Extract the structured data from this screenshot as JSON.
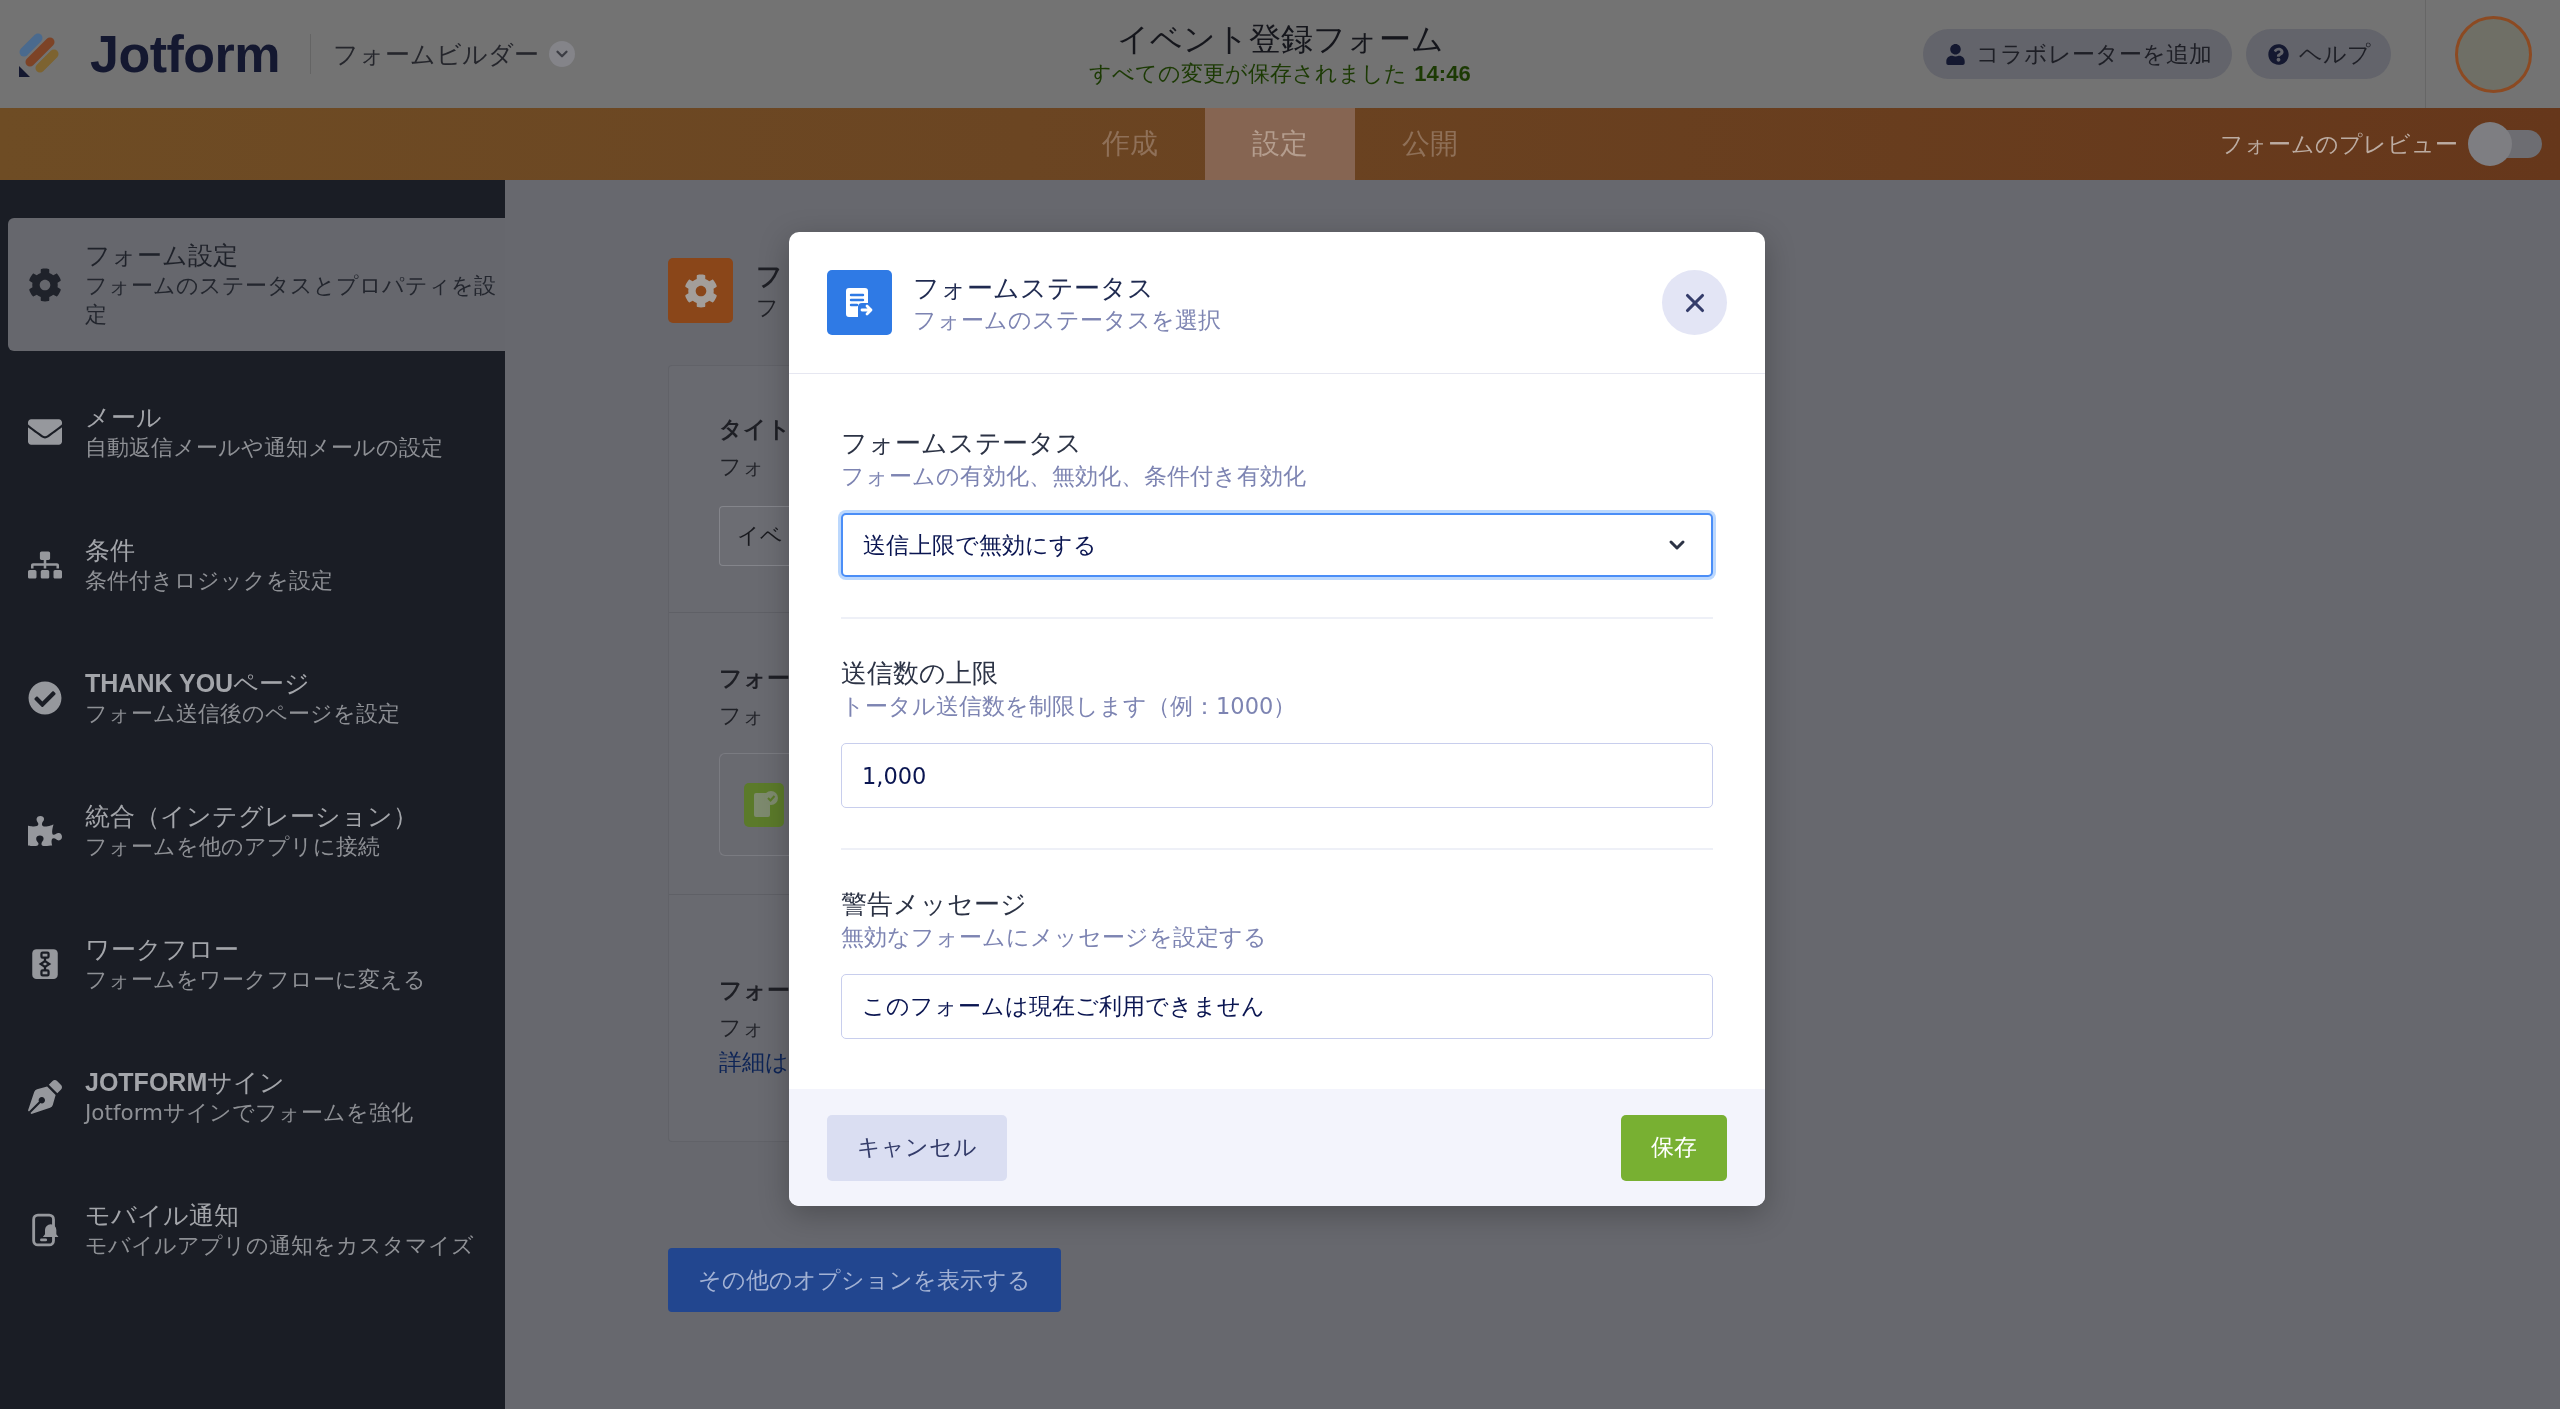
{
  "header": {
    "logo": "Jotform",
    "builder_menu": "フォームビルダー",
    "form_title": "イベント登録フォーム",
    "save_status": "すべての変更が保存されました",
    "save_time": "14:46",
    "buttons": [
      {
        "kind": "collaborator",
        "label": "コラボレーターを追加"
      },
      {
        "kind": "help",
        "label": "ヘルプ"
      }
    ]
  },
  "nav": {
    "tabs": [
      {
        "label": "作成",
        "selected": false
      },
      {
        "label": "設定",
        "selected": true
      },
      {
        "label": "公開",
        "selected": false
      }
    ],
    "preview": {
      "label": "フォームのプレビュー",
      "on": false
    }
  },
  "sidebar": {
    "items": [
      {
        "kind": "settings",
        "title": "フォーム設定",
        "subtitle": "フォームのステータスとプロパティを設定",
        "selected": true
      },
      {
        "kind": "email",
        "title": "メール",
        "subtitle": "自動返信メールや通知メールの設定",
        "selected": false
      },
      {
        "kind": "conditions",
        "title": "条件",
        "subtitle": "条件付きロジックを設定",
        "selected": false
      },
      {
        "kind": "thankyou",
        "title": "**THANK YOU**ページ",
        "subtitle": "フォーム送信後のページを設定",
        "selected": false
      },
      {
        "kind": "integrations",
        "title": "統合（インテグレーション）",
        "subtitle": "フォームを他のアプリに接続",
        "selected": false
      },
      {
        "kind": "workflow",
        "title": "ワークフロー",
        "subtitle": "フォームをワークフローに変える",
        "selected": false
      },
      {
        "kind": "sign",
        "title": "**JOTFORM**サイン",
        "subtitle": "Jotformサインでフォームを強化",
        "selected": false
      },
      {
        "kind": "mobile",
        "title": "モバイル通知",
        "subtitle": "モバイルアプリの通知をカスタマイズ",
        "selected": false
      }
    ]
  },
  "main": {
    "title": "フ",
    "subtitle": "フ",
    "sections": [
      {
        "kind": "input",
        "title": "タイト",
        "subtitle": "フォ",
        "value": "イベ"
      },
      {
        "kind": "status",
        "title": "フォー",
        "subtitle": "フォ"
      },
      {
        "kind": "link",
        "title": "フォー",
        "subtitle": "フォ",
        "link": "詳細は"
      }
    ],
    "more_button": "その他のオプションを表示する"
  },
  "modal": {
    "title": "フォームステータス",
    "subtitle": "フォームのステータスを選択",
    "fields": [
      {
        "kind": "select",
        "label": "フォームステータス",
        "description": "フォームの有効化、無効化、条件付き有効化",
        "value": "送信上限で無効にする",
        "focused": true
      },
      {
        "kind": "input",
        "label": "送信数の上限",
        "description": "トータル送信数を制限します（例：1000）",
        "value": "1,000",
        "focused": false
      },
      {
        "kind": "input",
        "label": "警告メッセージ",
        "description": "無効なフォームにメッセージを設定する",
        "value": "このフォームは現在ご利用できません",
        "focused": false
      }
    ],
    "buttons": [
      {
        "kind": "cancel",
        "label": "キャンセル"
      },
      {
        "kind": "save",
        "label": "保存"
      }
    ]
  }
}
